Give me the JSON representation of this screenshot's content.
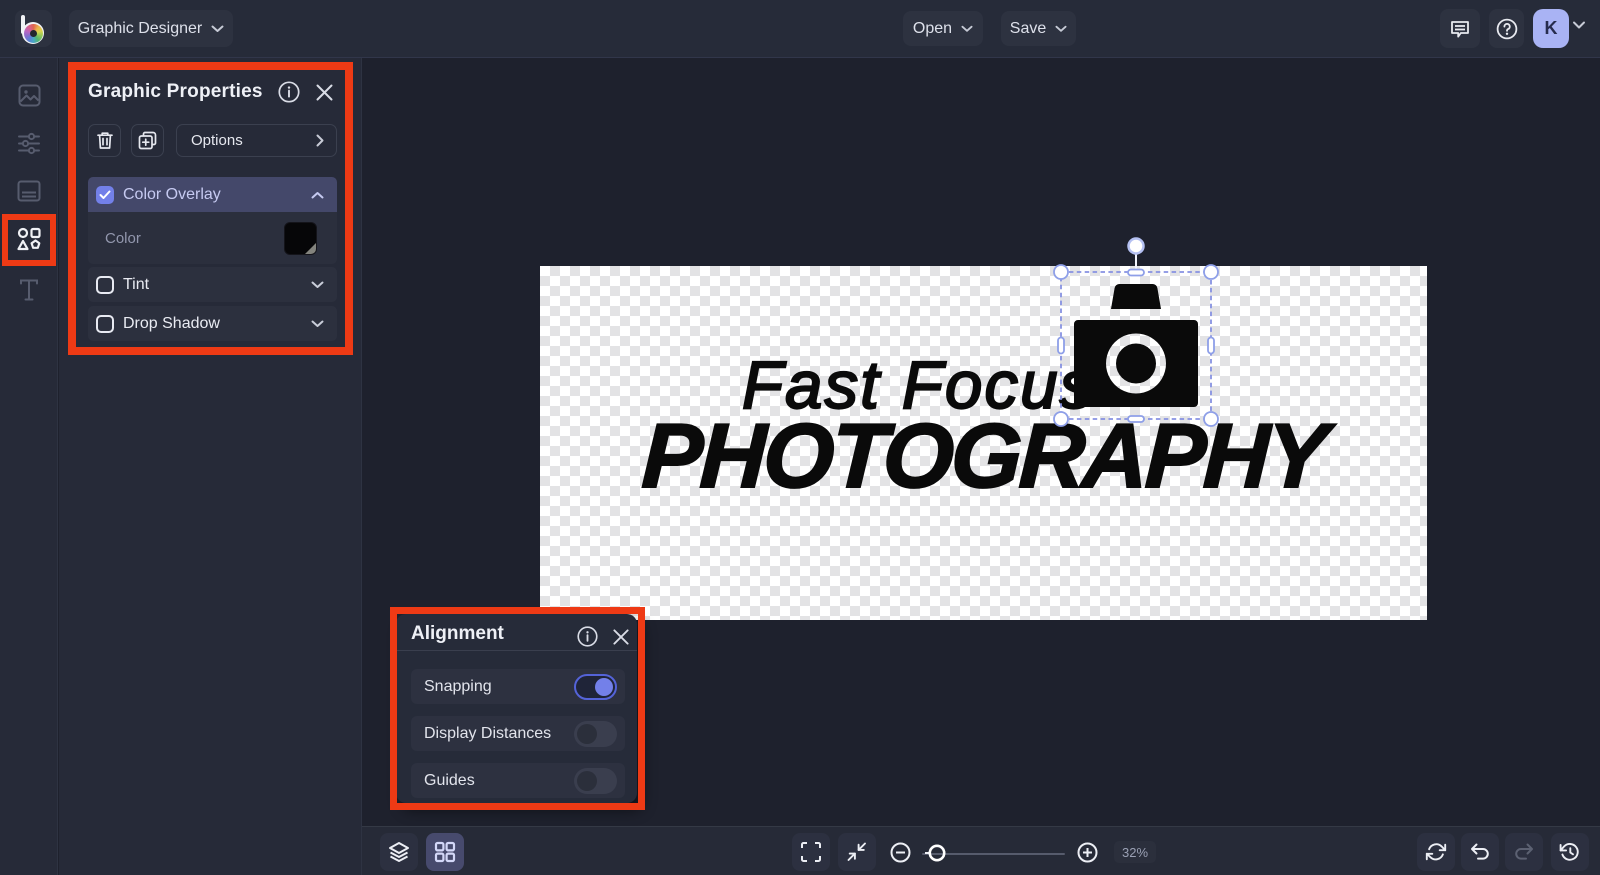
{
  "topbar": {
    "app_menu": "Graphic Designer",
    "open_label": "Open",
    "save_label": "Save",
    "avatar_initial": "K"
  },
  "sidebar": {
    "items": [
      {
        "icon": "image-icon",
        "active": false
      },
      {
        "icon": "adjustments-icon",
        "active": false
      },
      {
        "icon": "templates-icon",
        "active": false
      },
      {
        "icon": "shapes-icon",
        "active": true,
        "annotated": true
      },
      {
        "icon": "text-icon",
        "active": false
      }
    ]
  },
  "graphic_properties": {
    "title": "Graphic Properties",
    "options_label": "Options",
    "rows": {
      "color_overlay": {
        "label": "Color Overlay",
        "checked": true,
        "expanded": true
      },
      "color": {
        "label": "Color",
        "value": "#000000"
      },
      "tint": {
        "label": "Tint",
        "checked": false
      },
      "drop_shadow": {
        "label": "Drop Shadow",
        "checked": false
      }
    }
  },
  "alignment": {
    "title": "Alignment",
    "toggles": [
      {
        "label": "Snapping",
        "on": true
      },
      {
        "label": "Display Distances",
        "on": false
      },
      {
        "label": "Guides",
        "on": false
      }
    ]
  },
  "canvas": {
    "logo_line1": "Fast Focus",
    "logo_line2": "PHOTOGRAPHY"
  },
  "bottombar": {
    "zoom_value": "32%"
  },
  "colors": {
    "annotation_red": "#ee3a15",
    "accent_periwinkle": "#7380e9",
    "overlay_row_purple": "#44486a",
    "color_swatch": "#000000"
  }
}
